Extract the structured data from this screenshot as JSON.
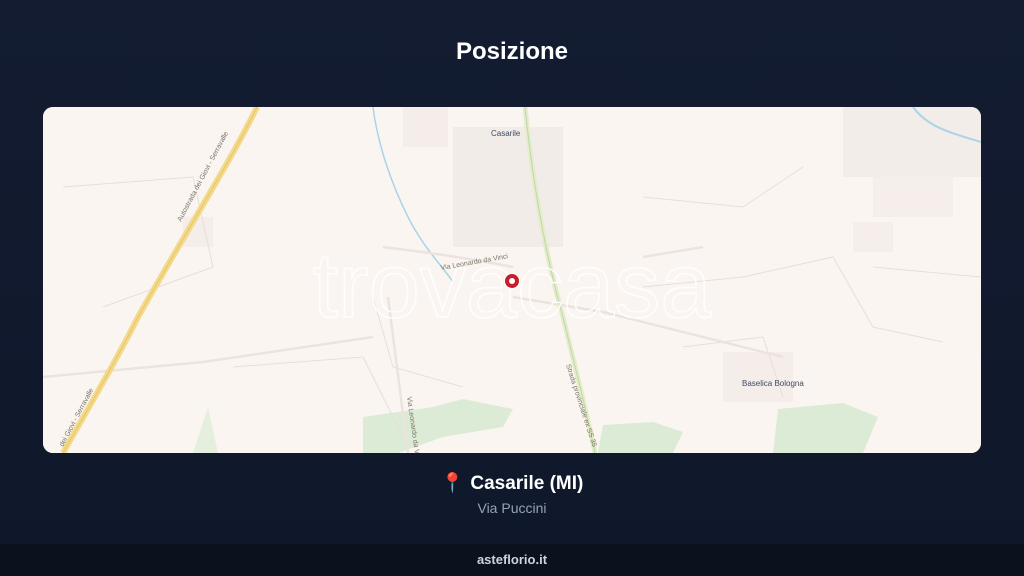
{
  "header": {
    "title": "Posizione"
  },
  "map": {
    "watermark": "trovacasa",
    "places": {
      "casarile": "Casarile",
      "baselica": "Baselica Bologna"
    },
    "roads": {
      "autostrada": "Autostrada dei Giovi - Serravalle",
      "autostrada_lower": "dei Giovi - Serravalle",
      "provinciale": "Strada provinciale ex SS 35",
      "leonardo": "Via Leonardo da Vinci",
      "leonardo_south": "Via Leonardo da Vinci"
    },
    "marker_icon": "map-marker-icon",
    "colors": {
      "land": "#fbf5f2",
      "highway": "#f3d98a",
      "water": "#a9d4e8",
      "park": "#dcebd6",
      "marker": "#c81e2c"
    }
  },
  "location": {
    "pin_icon": "pushpin-icon",
    "pin_glyph": "📍",
    "city": "Casarile (MI)",
    "street": "Via Puccini"
  },
  "footer": {
    "site": "asteflorio.it"
  }
}
